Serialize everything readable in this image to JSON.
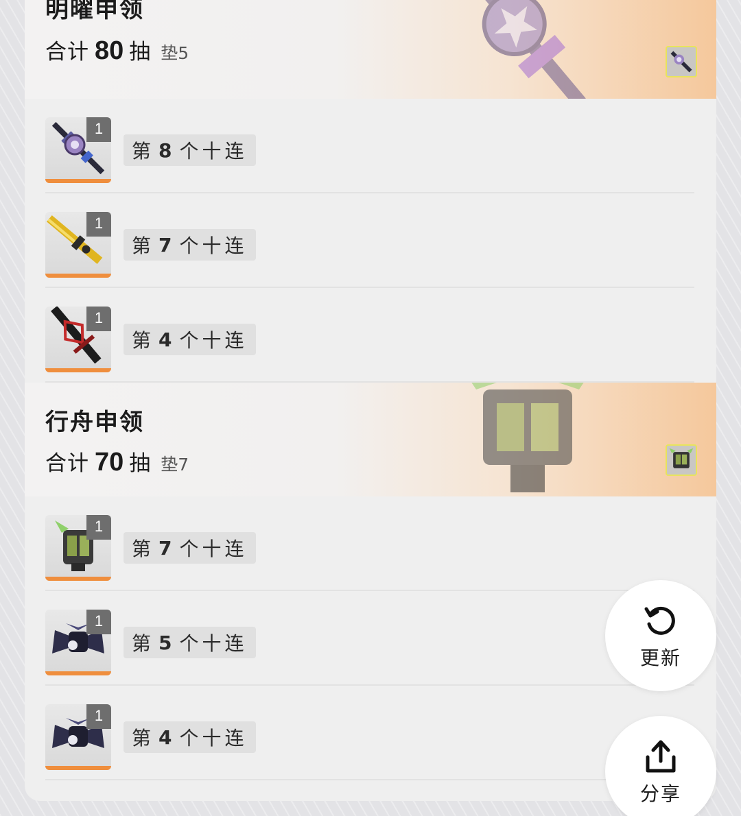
{
  "banners": [
    {
      "title": "明曜申领",
      "total_prefix": "合计",
      "total": "80",
      "total_suffix": "抽",
      "pity": "垫5",
      "items": [
        {
          "count": "1",
          "prefix": "第",
          "n": "8",
          "suffix": "个十连",
          "icon": "purple-weapon-icon"
        },
        {
          "count": "1",
          "prefix": "第",
          "n": "7",
          "suffix": "个十连",
          "icon": "gold-sword-icon"
        },
        {
          "count": "1",
          "prefix": "第",
          "n": "4",
          "suffix": "个十连",
          "icon": "red-blade-icon"
        }
      ]
    },
    {
      "title": "行舟申领",
      "total_prefix": "合计",
      "total": "70",
      "total_suffix": "抽",
      "pity": "垫7",
      "items": [
        {
          "count": "1",
          "prefix": "第",
          "n": "7",
          "suffix": "个十连",
          "icon": "green-mech-icon"
        },
        {
          "count": "1",
          "prefix": "第",
          "n": "5",
          "suffix": "个十连",
          "icon": "dark-drone-icon"
        },
        {
          "count": "1",
          "prefix": "第",
          "n": "4",
          "suffix": "个十连",
          "icon": "dark-drone-icon"
        }
      ]
    }
  ],
  "actions": {
    "refresh_label": "更新",
    "share_label": "分享"
  },
  "colors": {
    "rarity_bar": "#ef8e3d",
    "banner_accent": "#f5c89c"
  }
}
